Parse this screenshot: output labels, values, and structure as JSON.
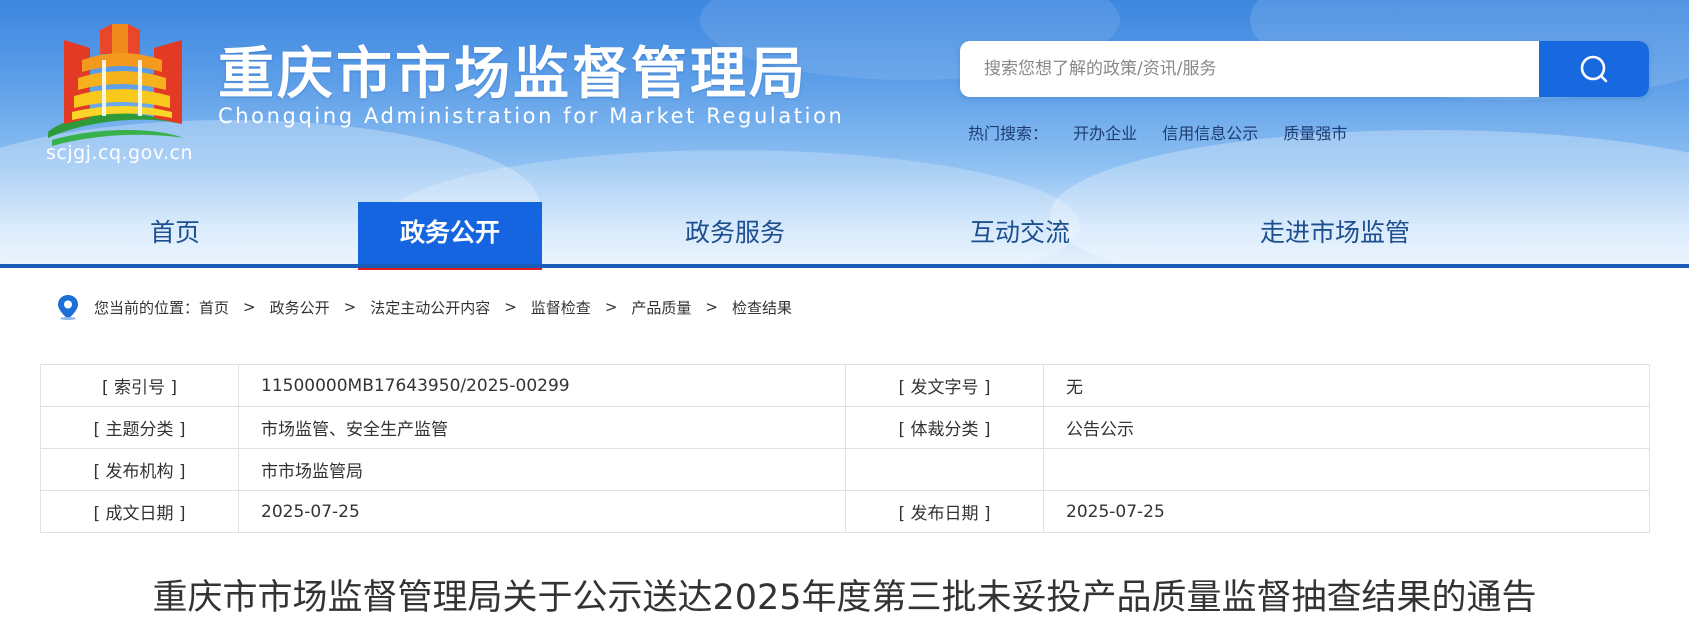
{
  "header": {
    "site_title": "重庆市市场监督管理局",
    "site_subtitle": "Chongqing  Administration for Market Regulation",
    "site_url": "scjgj.cq.gov.cn",
    "search_placeholder": "搜索您想了解的政策/资讯/服务",
    "hot_search_label": "热门搜索：",
    "hot_search_items": [
      "开办企业",
      "信用信息公示",
      "质量强市"
    ]
  },
  "nav": {
    "items": [
      "首页",
      "政务公开",
      "政务服务",
      "互动交流",
      "走进市场监管"
    ],
    "active": "政务公开"
  },
  "breadcrumb": {
    "prefix": "您当前的位置：",
    "items": [
      "首页",
      "政务公开",
      "法定主动公开内容",
      "监督检查",
      "产品质量",
      "检查结果"
    ],
    "separator": ">"
  },
  "meta": {
    "index_label": "[ 索引号 ]",
    "index_value": "11500000MB17643950/2025-00299",
    "doc_no_label": "[ 发文字号 ]",
    "doc_no_value": "无",
    "topic_label": "[ 主题分类 ]",
    "topic_value": "市场监管、安全生产监管",
    "genre_label": "[ 体裁分类 ]",
    "genre_value": "公告公示",
    "publisher_label": "[ 发布机构 ]",
    "publisher_value": "市市场监管局",
    "written_date_label": "[ 成文日期 ]",
    "written_date_value": "2025-07-25",
    "publish_date_label": "[ 发布日期 ]",
    "publish_date_value": "2025-07-25"
  },
  "article": {
    "title": "重庆市市场监督管理局关于公示送达2025年度第三批未妥投产品质量监督抽查结果的通告"
  },
  "colors": {
    "nav_active_bg": "#1565e0",
    "nav_active_underline": "#e21a1a",
    "search_button": "#1869e0",
    "nav_text": "#1d4f8f"
  },
  "icons": {
    "logo": "chongqing-amr-emblem",
    "search": "search-icon",
    "location": "location-pin-icon"
  }
}
